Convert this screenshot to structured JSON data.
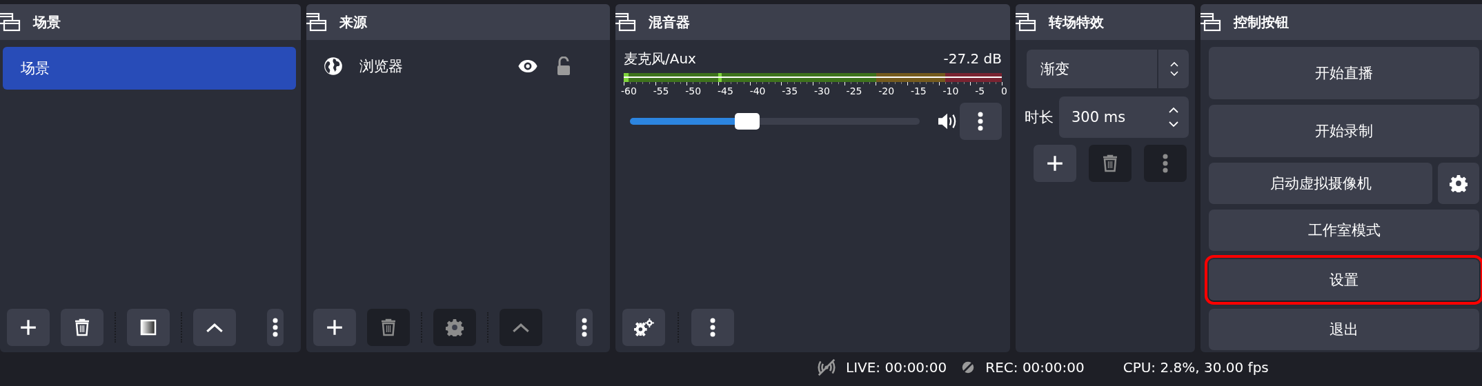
{
  "docks": [
    {
      "kind": "scenes",
      "title": "场景",
      "items": [
        {
          "label": "场景",
          "selected": true
        }
      ],
      "toolbar": [
        {
          "kind": "add",
          "disabled": false
        },
        {
          "kind": "remove",
          "disabled": false
        },
        {
          "kind": "separator"
        },
        {
          "kind": "filters",
          "disabled": false
        },
        {
          "kind": "separator"
        },
        {
          "kind": "up",
          "disabled": false
        },
        {
          "kind": "menu",
          "disabled": false
        }
      ]
    },
    {
      "kind": "sources",
      "title": "来源",
      "items": [
        {
          "label": "浏览器",
          "selected": false,
          "visible": true,
          "locked": false
        }
      ],
      "toolbar": [
        {
          "kind": "add",
          "disabled": false
        },
        {
          "kind": "remove",
          "disabled": true
        },
        {
          "kind": "separator"
        },
        {
          "kind": "properties",
          "disabled": true
        },
        {
          "kind": "separator"
        },
        {
          "kind": "up",
          "disabled": true
        },
        {
          "kind": "menu",
          "disabled": false
        }
      ]
    },
    {
      "kind": "mixer",
      "title": "混音器",
      "channels": [
        {
          "name": "麦克风/Aux",
          "reading": "-27.2 dB",
          "meter": {
            "level": 0.012
          },
          "peak": {
            "level": 0.25
          },
          "scale": [
            "-60",
            "-55",
            "-50",
            "-45",
            "-40",
            "-35",
            "-30",
            "-25",
            "-20",
            "-15",
            "-10",
            "-5",
            "0"
          ],
          "volume": {
            "level": 0.4
          },
          "muted": false
        }
      ],
      "toolbar": [
        {
          "kind": "advanced",
          "disabled": false
        },
        {
          "kind": "separator"
        },
        {
          "kind": "menu",
          "disabled": false
        }
      ]
    },
    {
      "kind": "transitions",
      "title": "转场特效",
      "transition": "渐变",
      "duration_label": "时长",
      "duration": "300 ms",
      "toolbar": [
        {
          "kind": "add",
          "disabled": false
        },
        {
          "kind": "remove",
          "disabled": true
        },
        {
          "kind": "menu",
          "disabled": true
        }
      ]
    },
    {
      "kind": "controls",
      "title": "控制按钮",
      "buttons": [
        {
          "kind": "tall",
          "label": "开始直播",
          "highlighted": false
        },
        {
          "kind": "tall",
          "label": "开始录制",
          "highlighted": false
        },
        {
          "kind": "with-gear",
          "label": "启动虚拟摄像机",
          "highlighted": false
        },
        {
          "kind": "plain",
          "label": "工作室模式",
          "highlighted": false
        },
        {
          "kind": "plain",
          "label": "设置",
          "highlighted": true
        },
        {
          "kind": "plain",
          "label": "退出",
          "highlighted": false
        }
      ]
    }
  ],
  "status_bar": {
    "live": "LIVE: 00:00:00",
    "rec": "REC: 00:00:00",
    "cpu": "CPU: 2.8%, 30.00 fps"
  }
}
